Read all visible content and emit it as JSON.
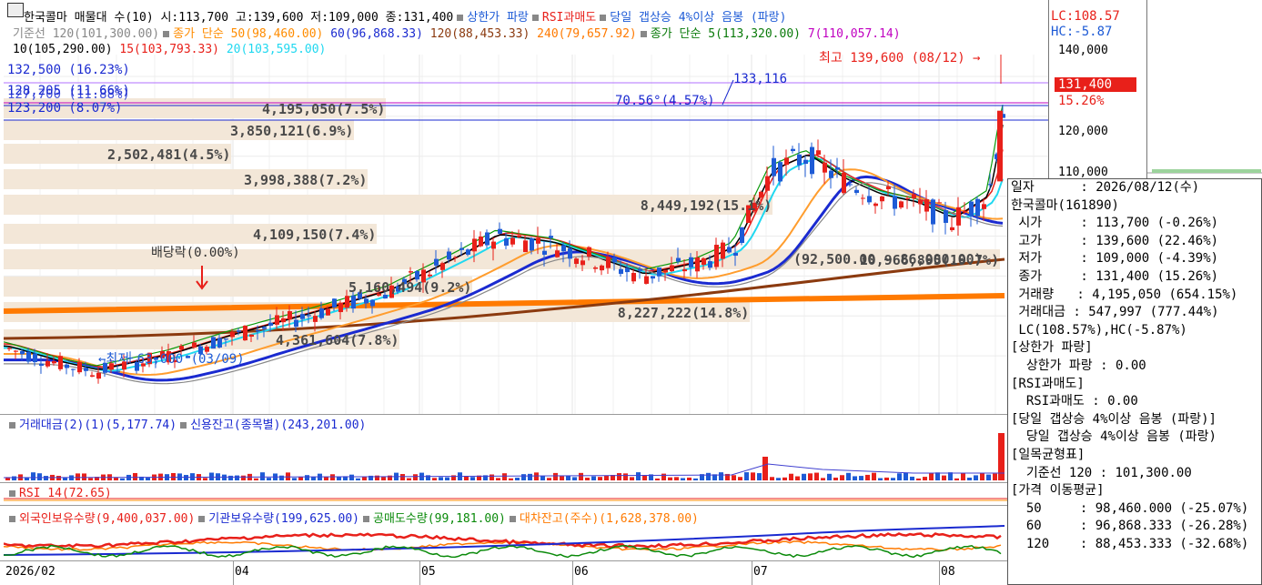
{
  "title_bar": {
    "stock_line": "한국콜마 매물대 수(10)  시:113,700 고:139,600 저:109,000 종:131,400",
    "cond1": "상한가 파랑",
    "cond2": "RSI과매도",
    "cond3": "당일 갭상승 4%이상 음봉 (파랑)",
    "lc": "LC:108.57",
    "hc": "HC:-5.87"
  },
  "legend_row2": {
    "base": "기준선 120(101,300.00)",
    "ma50": "종가 단순 50(98,460.00)",
    "ma60": "60(96,868.33)",
    "ma120": "120(88,453.33)",
    "ma240": "240(79,657.92)",
    "ma5": "종가 단순 5(113,320.00)",
    "ma7": "7(110,057.14)"
  },
  "legend_row3": {
    "ma10": "10(105,290.00)",
    "ma15": "15(103,793.33)",
    "ma20": "20(103,595.00)"
  },
  "price_labels": {
    "l1": "132,500 (16.23%)",
    "l2": "128,205 (11.66%)",
    "l2b": "127,700 (11.88%)",
    "l3": "123,200 (8.07%)",
    "high": "최고 139,600 (08/12) →",
    "low": "←최저 63,000 (03/09)",
    "dividend": "배당락(0.00%)",
    "fib_label": "70.56°(4.57%)",
    "fib_value": "133,116",
    "range": "(92,500.00 ~ 86,000.00)"
  },
  "volume_profile": [
    {
      "text": "4,195,050(7.5%)",
      "width": 420
    },
    {
      "text": "3,850,121(6.9%)",
      "width": 385
    },
    {
      "text": "2,502,481(4.5%)",
      "width": 250
    },
    {
      "text": "3,998,388(7.2%)",
      "width": 400
    },
    {
      "text": "8,449,192(15.1%)",
      "width": 845
    },
    {
      "text": "4,109,150(7.4%)",
      "width": 410
    },
    {
      "text": "10,966,895(19.7%)",
      "width": 1095
    },
    {
      "text": "5,160,494(9.2%)",
      "width": 515
    },
    {
      "text": "8,227,222(14.8%)",
      "width": 820
    },
    {
      "text": "4,361,604(7.8%)",
      "width": 435
    }
  ],
  "y_axis": [
    "140,000",
    "130,000",
    "120,000",
    "110,000"
  ],
  "current_price": "131,400",
  "current_pct": "15.26%",
  "volume_panel": {
    "label1": "거래대금(2)(1)(5,177.74)",
    "label2": "신용잔고(종목별)(243,201.00)"
  },
  "rsi_panel": {
    "label": "RSI 14(72.65)"
  },
  "holdings_panel": {
    "label1": "외국인보유수량(9,400,037.00)",
    "label2": "기관보유수량(199,625.00)",
    "label3": "공매도수량(99,181.00)",
    "label4": "대차잔고(주수)(1,628,378.00)"
  },
  "x_axis": [
    "2026/02",
    "04",
    "05",
    "06",
    "07",
    "08"
  ],
  "info_panel": [
    "일자      : 2026/08/12(수)",
    "한국콜마(161890)",
    " 시가     : 113,700 (-0.26%)",
    " 고가     : 139,600 (22.46%)",
    " 저가     : 109,000 (-4.39%)",
    " 종가     : 131,400 (15.26%)",
    " 거래량   : 4,195,050 (654.15%)",
    " 거래대금 : 547,997 (777.44%)",
    " LC(108.57%),HC(-5.87%)",
    "[상한가 파랑]",
    "  상한가 파랑 : 0.00",
    "[RSI과매도]",
    "  RSI과매도 : 0.00",
    "[당일 갭상승 4%이상 음봉 (파랑)]",
    "  당일 갭상승 4%이상 음봉 (파랑)",
    "[일목균형표]",
    "  기준선 120 : 101,300.00",
    "[가격 이동평균]",
    "  50     : 98,460.000 (-25.07%)",
    "  60     : 96,868.333 (-26.28%)",
    "  120    : 88,453.333 (-32.68%)"
  ],
  "colors": {
    "up": "#e8201a",
    "down": "#1e5bd6",
    "band": "#f3e7d8",
    "ma_orange": "#ff7a00",
    "ma_brown": "#8b3a0f",
    "ma_blue": "#1a2ad0",
    "ma_cyan": "#20d8f0"
  }
}
